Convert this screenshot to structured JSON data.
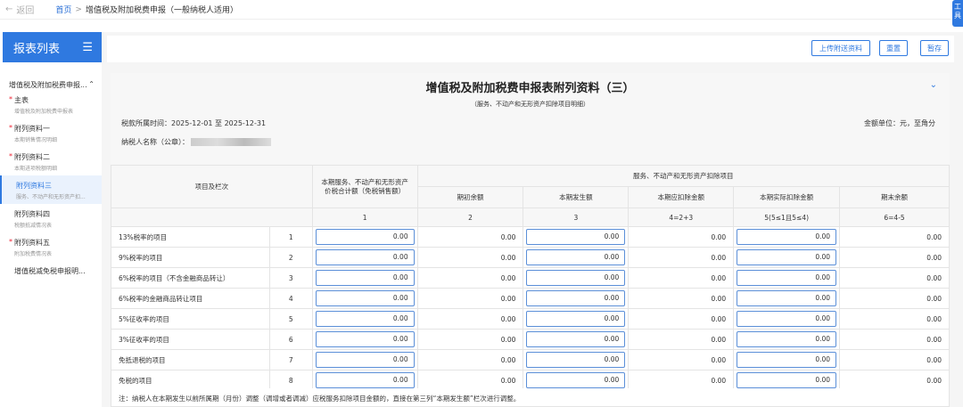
{
  "topbar": {
    "back_label": "返回",
    "home": "首页",
    "separator": ">",
    "current": "增值税及附加税费申报（一般纳税人适用）",
    "edge_tab": "工具"
  },
  "sidebar": {
    "title": "报表列表",
    "group": "增值税及附加税费申报...",
    "items": [
      {
        "label": "主表",
        "sub": "增值税及附加税费申报表",
        "required": "*"
      },
      {
        "label": "附列资料一",
        "sub": "本期销售情况明细",
        "required": "*"
      },
      {
        "label": "附列资料二",
        "sub": "本期进项税额明细",
        "required": "*"
      },
      {
        "label": "附列资料三",
        "sub": "服务、不动产和无形资产扣...",
        "required": ""
      },
      {
        "label": "附列资料四",
        "sub": "税额抵减情况表",
        "required": ""
      },
      {
        "label": "附列资料五",
        "sub": "附加税费情况表",
        "required": "*"
      },
      {
        "label": "增值税减免税申报明...",
        "sub": "",
        "required": ""
      }
    ]
  },
  "toolbar": {
    "upload_label": "上传附送资料",
    "reset_label": "重置",
    "save_label": "暂存"
  },
  "form": {
    "title": "增值税及附加税费申报表附列资料（三）",
    "subtitle": "（服务、不动产和无形资产扣除项目明细）",
    "period_label": "税款所属时间：2025-12-01 至 2025-12-31",
    "unit_label": "金额单位：元，至角分",
    "taxpayer_label": "纳税人名称（公章）："
  },
  "table": {
    "col_item": "项目及栏次",
    "col_1": "本期服务、不动产和无形资产价税合计额（免税销售额）",
    "col_group": "服务、不动产和无形资产扣除项目",
    "col_2": "期初余额",
    "col_3": "本期发生额",
    "col_4": "本期应扣除金额",
    "col_5": "本期实际扣除金额",
    "col_6": "期末余额",
    "idx": [
      "1",
      "2",
      "3",
      "4=2+3",
      "5(5≤1且5≤4)",
      "6=4-5"
    ],
    "rows": [
      {
        "name": "13%税率的项目",
        "no": "1",
        "v": [
          "0.00",
          "0.00",
          "0.00",
          "0.00",
          "0.00",
          "0.00"
        ]
      },
      {
        "name": "9%税率的项目",
        "no": "2",
        "v": [
          "0.00",
          "0.00",
          "0.00",
          "0.00",
          "0.00",
          "0.00"
        ]
      },
      {
        "name": "6%税率的项目（不含金融商品转让）",
        "no": "3",
        "v": [
          "0.00",
          "0.00",
          "0.00",
          "0.00",
          "0.00",
          "0.00"
        ]
      },
      {
        "name": "6%税率的金融商品转让项目",
        "no": "4",
        "v": [
          "0.00",
          "0.00",
          "0.00",
          "0.00",
          "0.00",
          "0.00"
        ]
      },
      {
        "name": "5%征收率的项目",
        "no": "5",
        "v": [
          "0.00",
          "0.00",
          "0.00",
          "0.00",
          "0.00",
          "0.00"
        ]
      },
      {
        "name": "3%征收率的项目",
        "no": "6",
        "v": [
          "0.00",
          "0.00",
          "0.00",
          "0.00",
          "0.00",
          "0.00"
        ]
      },
      {
        "name": "免抵退税的项目",
        "no": "7",
        "v": [
          "0.00",
          "0.00",
          "0.00",
          "0.00",
          "0.00",
          "0.00"
        ]
      },
      {
        "name": "免税的项目",
        "no": "8",
        "v": [
          "0.00",
          "0.00",
          "0.00",
          "0.00",
          "0.00",
          "0.00"
        ]
      }
    ],
    "note": "注：纳税人在本期发生以前所属期（月份）调整（调增或者调减）应税服务扣除项目金额的，直接在第三列“本期发生额”栏次进行调整。"
  }
}
